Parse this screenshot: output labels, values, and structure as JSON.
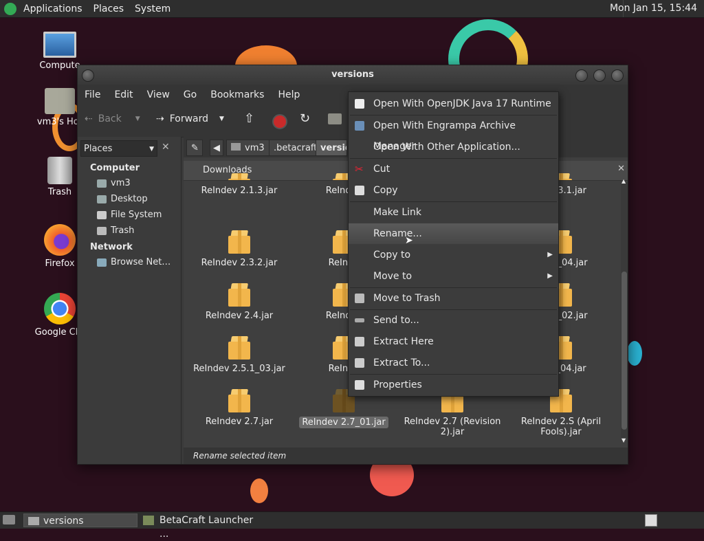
{
  "panel": {
    "menus": [
      "Applications",
      "Places",
      "System"
    ],
    "clock": "Mon Jan 15, 15:44"
  },
  "desktop": {
    "icons": [
      "Computer",
      "vm3's Home",
      "Trash",
      "Firefox",
      "Google Chrome"
    ],
    "icon_labels_visible": [
      "Compute",
      "vm3's Hor",
      "Trash",
      "Firefox",
      "Google Chr"
    ]
  },
  "window": {
    "title": "versions",
    "menubar": [
      "File",
      "Edit",
      "View",
      "Go",
      "Bookmarks",
      "Help"
    ],
    "toolbar": {
      "back": "Back",
      "forward": "Forward"
    },
    "places_select": "Places",
    "sidebar": {
      "computer_header": "Computer",
      "computer_items": [
        "vm3",
        "Desktop",
        "File System",
        "Trash"
      ],
      "network_header": "Network",
      "network_items": [
        "Browse Net…"
      ]
    },
    "breadcrumbs": [
      "vm3",
      ".betacraft",
      "versio"
    ],
    "pane_tab": "Downloads",
    "files": [
      [
        "ReIndev 2.1.3.jar",
        "ReIndev",
        "",
        "ev 2.3.1.jar"
      ],
      [
        "ReIndev 2.3.2.jar",
        "ReInde",
        "",
        "2.4.5_04.jar"
      ],
      [
        "ReIndev 2.4.jar",
        "ReIndev",
        "",
        "2.5.1_02.jar"
      ],
      [
        "ReIndev 2.5.1_03.jar",
        "ReInde",
        "",
        "/ 2.6_04.jar"
      ],
      [
        "ReIndev 2.7.jar",
        "ReIndev 2.7_01.jar",
        "ReIndev 2.7 (Revision 2).jar",
        "ReIndev 2.S (April Fools).jar"
      ]
    ],
    "status": "Rename selected item"
  },
  "context_menu": {
    "items": [
      "Open With OpenJDK Java 17 Runtime",
      "Open With Engrampa Archive Manager",
      "Open With Other Application...",
      "Cut",
      "Copy",
      "Make Link",
      "Rename...",
      "Copy to",
      "Move to",
      "Move to Trash",
      "Send to...",
      "Extract Here",
      "Extract To...",
      "Properties"
    ],
    "highlighted": "Rename..."
  },
  "taskbar": {
    "tasks": [
      "versions",
      "BetaCraft Launcher ..."
    ]
  }
}
